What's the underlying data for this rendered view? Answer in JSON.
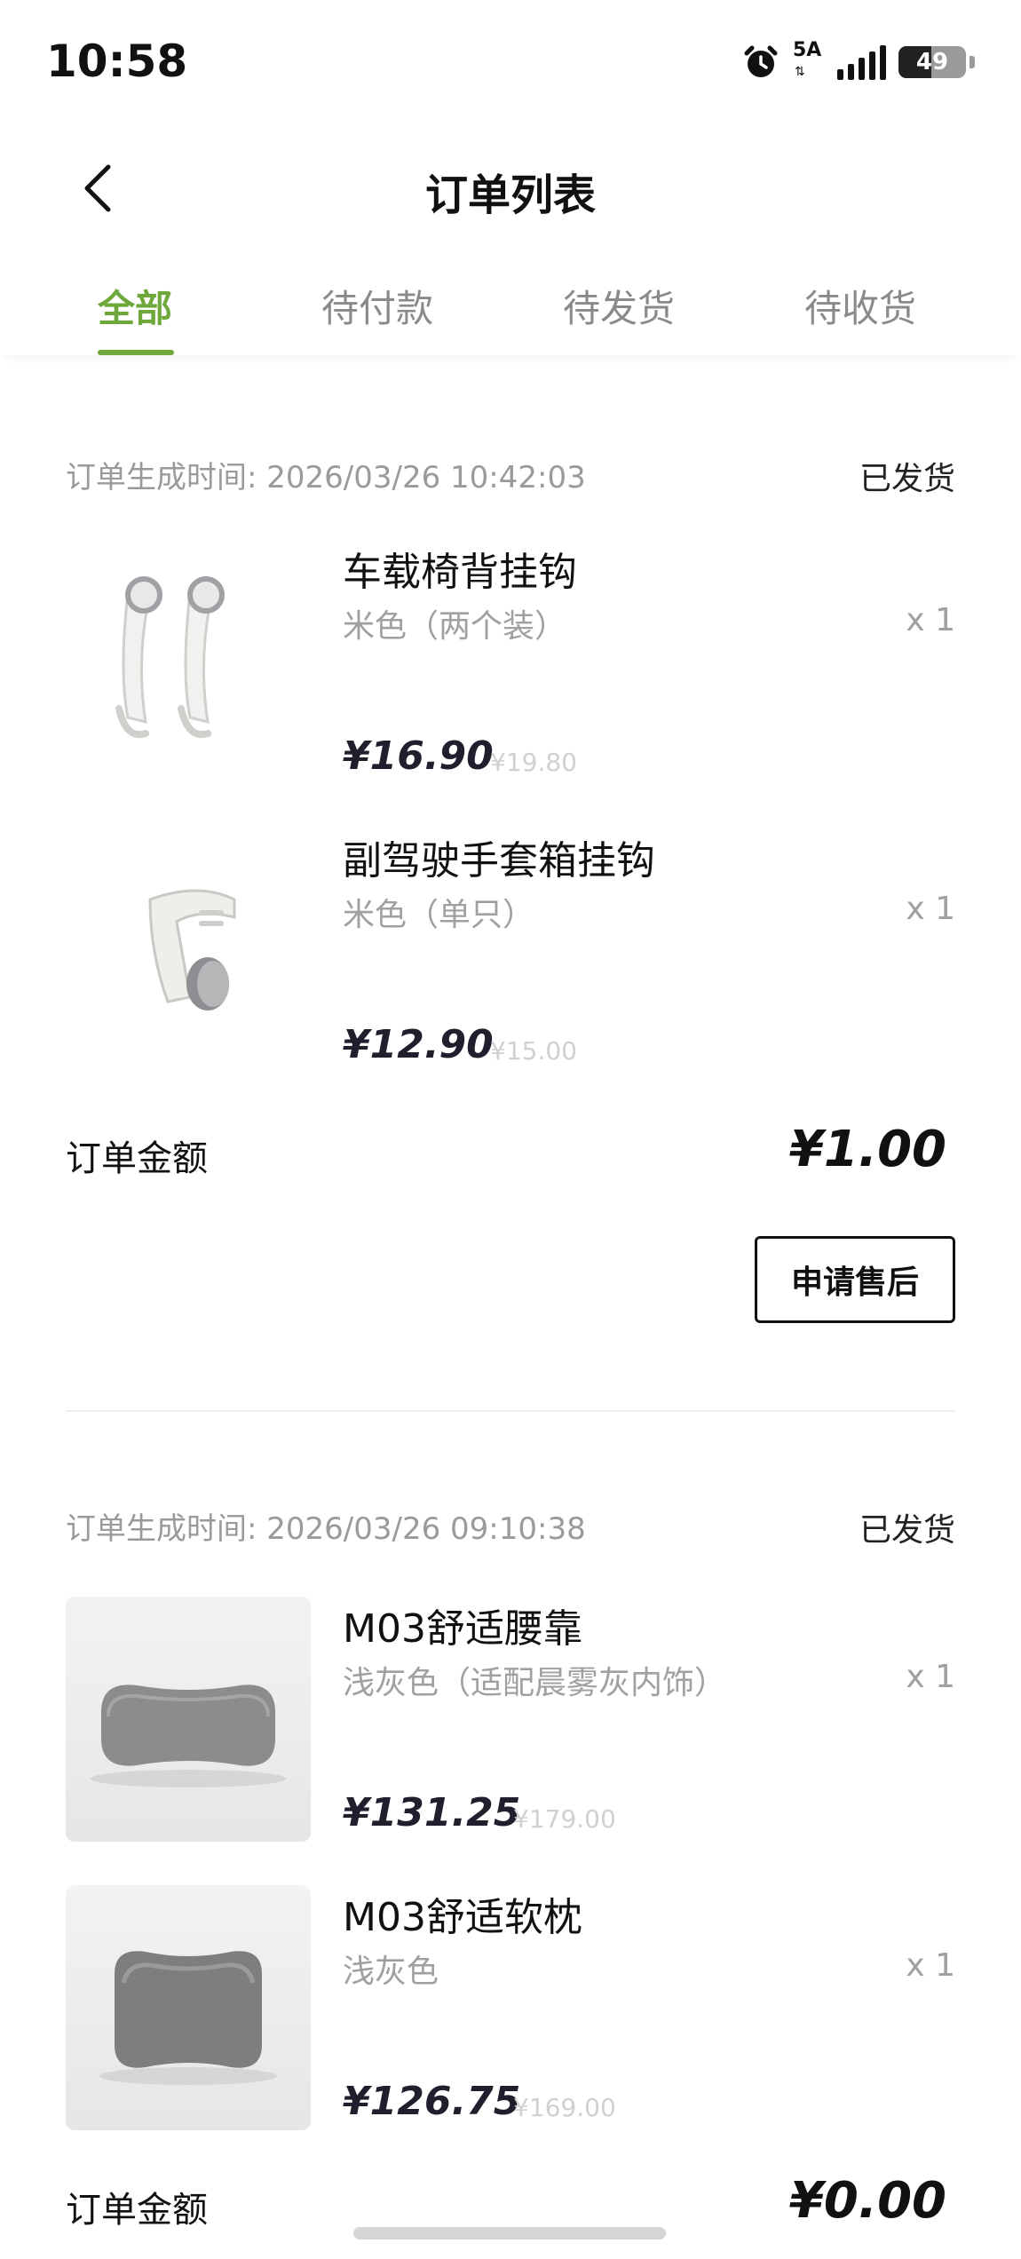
{
  "status_bar": {
    "time": "10:58",
    "network": "5A",
    "battery": "49",
    "battery_level": 0.49
  },
  "header": {
    "title": "订单列表"
  },
  "tabs": [
    {
      "label": "全部",
      "active": true
    },
    {
      "label": "待付款",
      "active": false
    },
    {
      "label": "待发货",
      "active": false
    },
    {
      "label": "待收货",
      "active": false
    }
  ],
  "orders": [
    {
      "time_label": "订单生成时间:  2026/03/26 10:42:03",
      "status": "已发货",
      "items": [
        {
          "name": "车载椅背挂钩",
          "spec": "米色（两个装）",
          "qty": "x 1",
          "price": "¥16.90",
          "orig_price": "¥19.80",
          "icon": "seat-hook-image"
        },
        {
          "name": "副驾驶手套箱挂钩",
          "spec": "米色（单只）",
          "qty": "x 1",
          "price": "¥12.90",
          "orig_price": "¥15.00",
          "icon": "glovebox-hook-image"
        }
      ],
      "total_label": "订单金额",
      "total_value": "¥1.00",
      "action_label": "申请售后"
    },
    {
      "time_label": "订单生成时间:  2026/03/26 09:10:38",
      "status": "已发货",
      "items": [
        {
          "name": "M03舒适腰靠",
          "spec": "浅灰色（适配晨雾灰内饰）",
          "qty": "x 1",
          "price": "¥131.25",
          "orig_price": "¥179.00",
          "icon": "lumbar-pillow-image"
        },
        {
          "name": "M03舒适软枕",
          "spec": "浅灰色",
          "qty": "x 1",
          "price": "¥126.75",
          "orig_price": "¥169.00",
          "icon": "soft-pillow-image"
        }
      ],
      "total_label": "订单金额",
      "total_value": "¥0.00"
    }
  ],
  "colors": {
    "accent": "#6ea83a",
    "text": "#111111",
    "muted": "#9a9a9a"
  }
}
